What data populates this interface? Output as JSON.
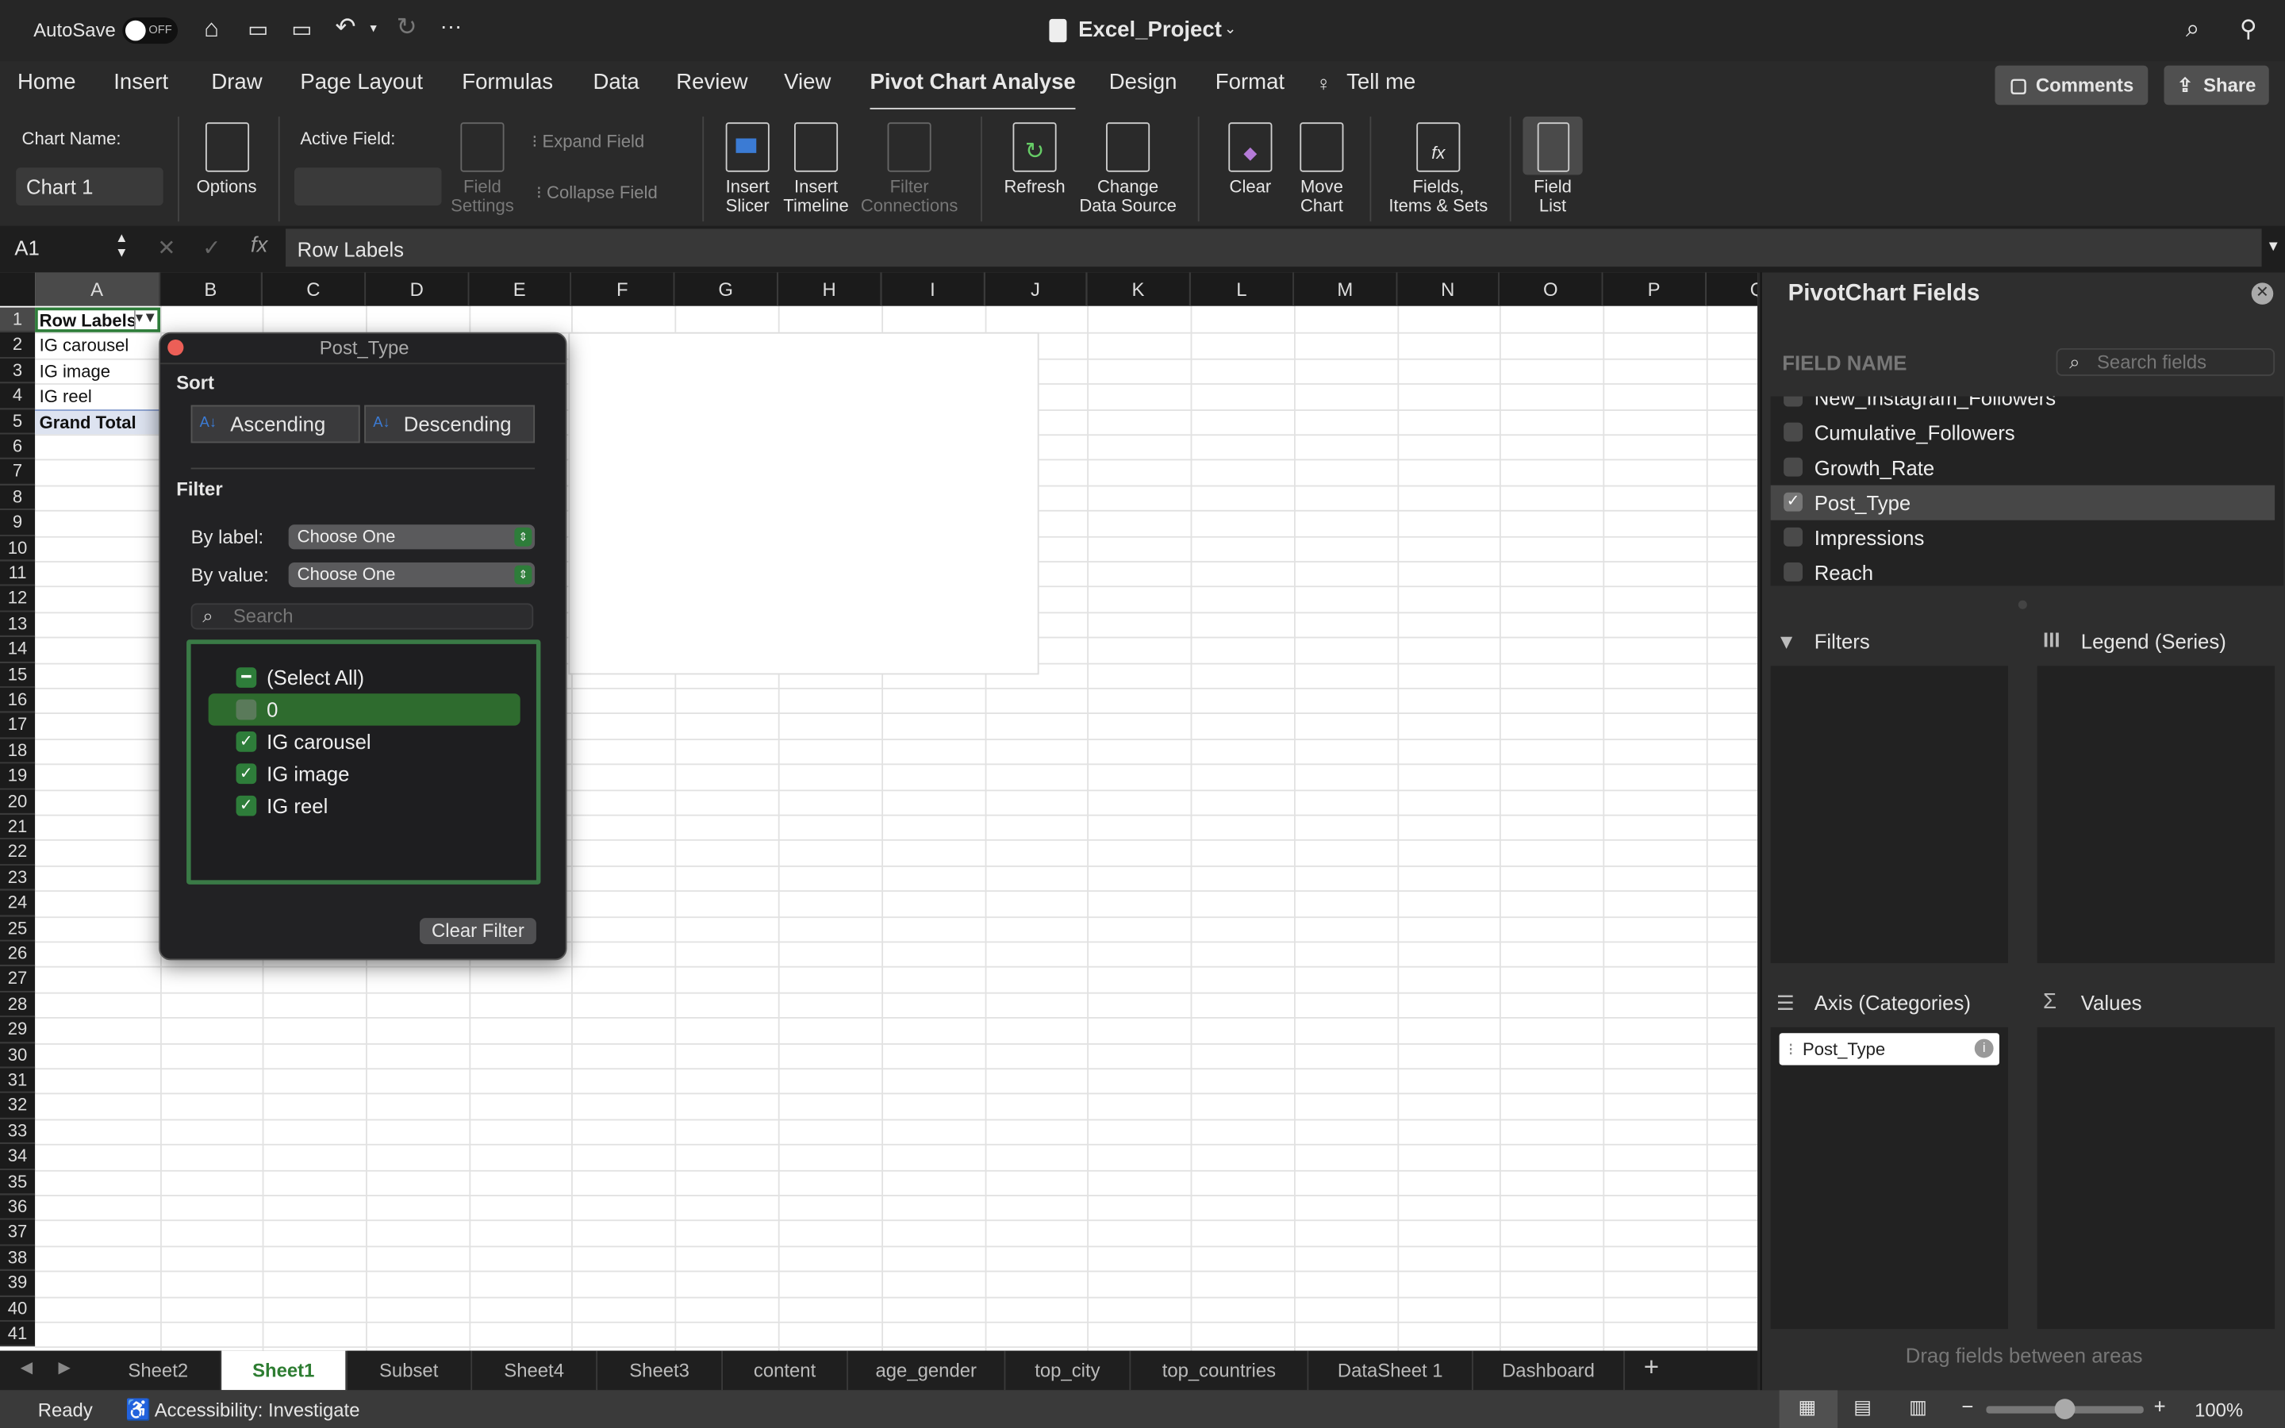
{
  "titlebar": {
    "autosave": "AutoSave",
    "autosave_state": "OFF",
    "doc_title": "Excel_Project"
  },
  "tabs": [
    "Home",
    "Insert",
    "Draw",
    "Page Layout",
    "Formulas",
    "Data",
    "Review",
    "View",
    "Pivot Chart Analyse",
    "Design",
    "Format",
    "Tell me"
  ],
  "active_tab": "Pivot Chart Analyse",
  "header_buttons": {
    "comments": "Comments",
    "share": "Share"
  },
  "ribbon": {
    "chart_name_label": "Chart Name:",
    "chart_name_value": "Chart 1",
    "options": "Options",
    "active_field_label": "Active Field:",
    "field_settings": [
      "Field",
      "Settings"
    ],
    "expand_field": "Expand Field",
    "collapse_field": "Collapse Field",
    "insert_slicer": [
      "Insert",
      "Slicer"
    ],
    "insert_timeline": [
      "Insert",
      "Timeline"
    ],
    "filter_connections": [
      "Filter",
      "Connections"
    ],
    "refresh": [
      "Refresh",
      ""
    ],
    "change_data_source": [
      "Change",
      "Data Source"
    ],
    "clear": [
      "Clear",
      ""
    ],
    "move_chart": [
      "Move",
      "Chart"
    ],
    "fields_items_sets": [
      "Fields,",
      "Items & Sets"
    ],
    "field_list": [
      "Field",
      "List"
    ]
  },
  "formula_bar": {
    "name_box": "A1",
    "fx": "fx",
    "formula": "Row Labels"
  },
  "columns": [
    "A",
    "B",
    "C",
    "D",
    "E",
    "F",
    "G",
    "H",
    "I",
    "J",
    "K",
    "L",
    "M",
    "N",
    "O",
    "P",
    "Q"
  ],
  "rows": [
    "1",
    "2",
    "3",
    "4",
    "5",
    "6",
    "7",
    "8",
    "9",
    "10",
    "11",
    "12",
    "13",
    "14",
    "15",
    "16",
    "17",
    "18",
    "19",
    "20",
    "21",
    "22",
    "23",
    "24",
    "25",
    "26",
    "27",
    "28",
    "29",
    "30",
    "31",
    "32",
    "33",
    "34",
    "35",
    "36",
    "37",
    "38",
    "39",
    "40",
    "41"
  ],
  "cells": {
    "A1": "Row Labels",
    "A2": "IG carousel",
    "A3": "IG image",
    "A4": "IG reel",
    "A5": "Grand Total"
  },
  "filter_dialog": {
    "title": "Post_Type",
    "sort_label": "Sort",
    "ascending": "Ascending",
    "descending": "Descending",
    "filter_label": "Filter",
    "by_label": "By label:",
    "by_label_value": "Choose One",
    "by_value": "By value:",
    "by_value_value": "Choose One",
    "search_placeholder": "Search",
    "items": [
      {
        "label": "(Select All)",
        "state": "mixed"
      },
      {
        "label": "0",
        "state": "unchecked"
      },
      {
        "label": "IG carousel",
        "state": "checked"
      },
      {
        "label": "IG image",
        "state": "checked"
      },
      {
        "label": "IG reel",
        "state": "checked"
      }
    ],
    "clear_filter": "Clear Filter"
  },
  "sheet_tabs": [
    "Sheet2",
    "Sheet1",
    "Subset",
    "Sheet4",
    "Sheet3",
    "content",
    "age_gender",
    "top_city",
    "top_countries",
    "DataSheet 1",
    "Dashboard"
  ],
  "active_sheet": "Sheet1",
  "status": {
    "ready": "Ready",
    "accessibility": "Accessibility: Investigate",
    "zoom": "100%",
    "zoom_fraction": 0.5
  },
  "pivot_panel": {
    "title": "PivotChart Fields",
    "field_name_label": "FIELD NAME",
    "search_placeholder": "Search fields",
    "fields": [
      {
        "label": "New_Instagram_Followers",
        "checked": false
      },
      {
        "label": "Cumulative_Followers",
        "checked": false
      },
      {
        "label": "Growth_Rate",
        "checked": false
      },
      {
        "label": "Post_Type",
        "checked": true
      },
      {
        "label": "Impressions",
        "checked": false
      },
      {
        "label": "Reach",
        "checked": false
      }
    ],
    "filters": "Filters",
    "legend": "Legend (Series)",
    "axis": "Axis (Categories)",
    "values": "Values",
    "axis_items": [
      "Post_Type"
    ],
    "hint": "Drag fields between areas"
  },
  "colors": {
    "accent_green": "#2e7d3a",
    "selected_sheet_text": "#2e7d32"
  }
}
